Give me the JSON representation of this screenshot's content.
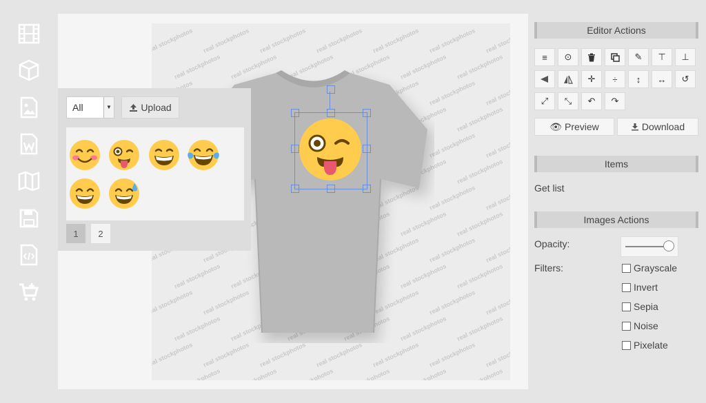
{
  "sidebar": {
    "icons": [
      "film-icon",
      "cube-icon",
      "image-icon",
      "word-document-icon",
      "map-icon",
      "save-icon",
      "code-file-icon",
      "add-to-cart-icon"
    ]
  },
  "canvas": {
    "watermark_text": "real stockphotos",
    "shirt_color": "#b9b9b9",
    "selection_color": "#6a8fd8"
  },
  "picker": {
    "category_selected": "All",
    "upload_label": "Upload",
    "emojis": [
      "smiling-blush-emoji",
      "winking-tongue-emoji",
      "grinning-squint-emoji",
      "tears-of-joy-emoji",
      "grinning-emoji",
      "grinning-sweat-emoji"
    ],
    "pages": [
      "1",
      "2"
    ],
    "active_page": "1"
  },
  "editor_actions": {
    "title": "Editor Actions",
    "tools_row1": [
      "align-justify-icon",
      "center-target-icon",
      "trash-icon",
      "copy-icon",
      "pencil-icon",
      "align-top-icon",
      "align-bottom-icon"
    ],
    "tools_row2": [
      "flip-horizontal-icon",
      "flip-vertical-icon",
      "center-horizontal-icon",
      "center-vertical-icon",
      "stretch-vertical-icon",
      "stretch-horizontal-icon",
      "reset-icon"
    ],
    "tools_row3": [
      "enlarge-icon",
      "shrink-icon",
      "undo-icon",
      "redo-icon"
    ],
    "preview_label": "Preview",
    "download_label": "Download"
  },
  "items": {
    "title": "Items",
    "get_list_label": "Get list"
  },
  "images_actions": {
    "title": "Images Actions",
    "opacity_label": "Opacity:",
    "opacity_value": 0.95,
    "filters_label": "Filters:",
    "filters": [
      "Grayscale",
      "Invert",
      "Sepia",
      "Noise",
      "Pixelate"
    ]
  }
}
